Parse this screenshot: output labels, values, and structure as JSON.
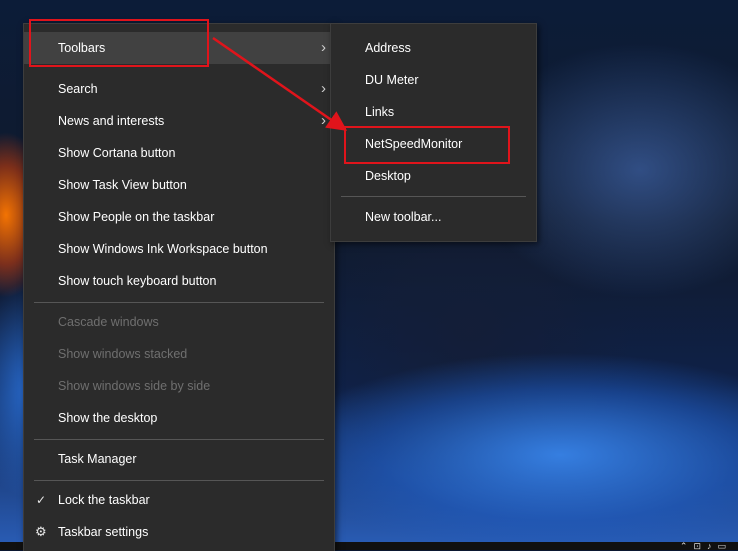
{
  "main_menu": {
    "items": [
      {
        "label": "Toolbars"
      },
      {
        "label": "Search"
      },
      {
        "label": "News and interests"
      },
      {
        "label": "Show Cortana button"
      },
      {
        "label": "Show Task View button"
      },
      {
        "label": "Show People on the taskbar"
      },
      {
        "label": "Show Windows Ink Workspace button"
      },
      {
        "label": "Show touch keyboard button"
      },
      {
        "label": "Cascade windows"
      },
      {
        "label": "Show windows stacked"
      },
      {
        "label": "Show windows side by side"
      },
      {
        "label": "Show the desktop"
      },
      {
        "label": "Task Manager"
      },
      {
        "label": "Lock the taskbar"
      },
      {
        "label": "Taskbar settings"
      }
    ]
  },
  "toolbars_submenu": {
    "items": [
      {
        "label": "Address"
      },
      {
        "label": "DU Meter"
      },
      {
        "label": "Links"
      },
      {
        "label": "NetSpeedMonitor"
      },
      {
        "label": "Desktop"
      },
      {
        "label": "New toolbar..."
      }
    ]
  },
  "annotation": {
    "color": "#e0141b"
  },
  "icons": {
    "submenu_arrow": "chevron-right-icon",
    "lock_check": "checkmark-icon",
    "settings": "gear-icon"
  }
}
